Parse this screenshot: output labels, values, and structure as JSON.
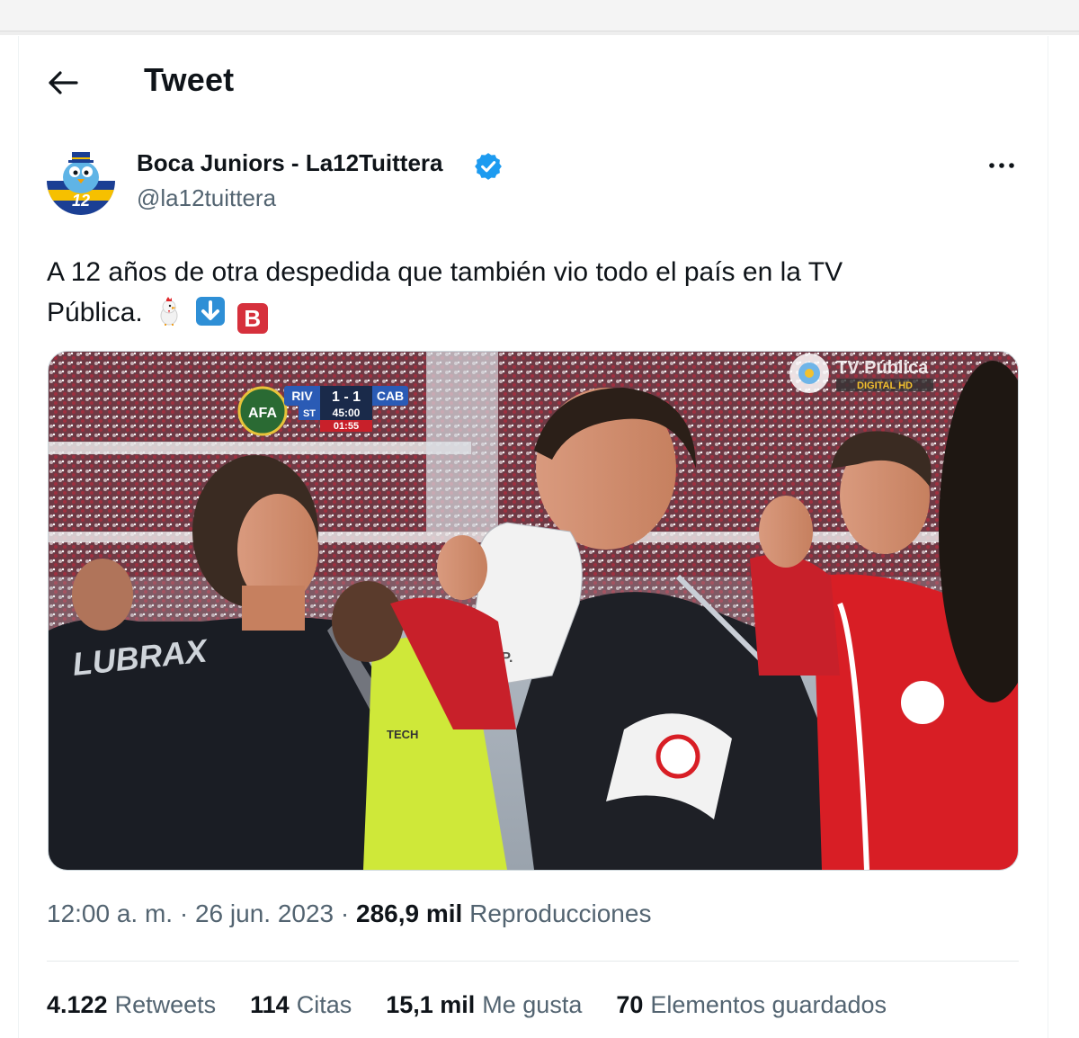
{
  "header": {
    "title": "Tweet",
    "back_icon": "arrow-left-icon"
  },
  "author": {
    "display_name": "Boca Juniors - La12Tuittera",
    "handle": "@la12tuittera",
    "verified": true,
    "avatar_badge": "12"
  },
  "tweet": {
    "text_line1": "A 12 años de otra despedida que también vio todo el país en la TV",
    "text_line2": "Pública.",
    "emojis": [
      "chicken-icon",
      "down-arrow-icon",
      "b-letter-icon"
    ],
    "emoji_b": "B"
  },
  "media": {
    "scoreboard": {
      "home": "RIV",
      "score": "1 - 1",
      "away": "CAB",
      "period": "ST",
      "time": "45:00",
      "added": "01:55"
    },
    "broadcaster": "TV Pública",
    "broadcaster_sub": "DIGITAL HD",
    "shirt_text": "LUBRAX",
    "glove_text": "J.P."
  },
  "meta": {
    "time": "12:00 a. m.",
    "sep1": " · ",
    "date": "26 jun. 2023",
    "sep2": " · ",
    "views_count": "286,9 mil",
    "views_label": "Reproducciones"
  },
  "stats": [
    {
      "count": "4.122",
      "label": "Retweets"
    },
    {
      "count": "114",
      "label": "Citas"
    },
    {
      "count": "15,1 mil",
      "label": "Me gusta"
    },
    {
      "count": "70",
      "label": "Elementos guardados"
    }
  ],
  "colors": {
    "text": "#0f1419",
    "secondary": "#536471",
    "verified": "#1d9bf0",
    "boca_blue": "#1b3f94",
    "boca_yellow": "#f6c000",
    "river_red": "#d81e25"
  }
}
